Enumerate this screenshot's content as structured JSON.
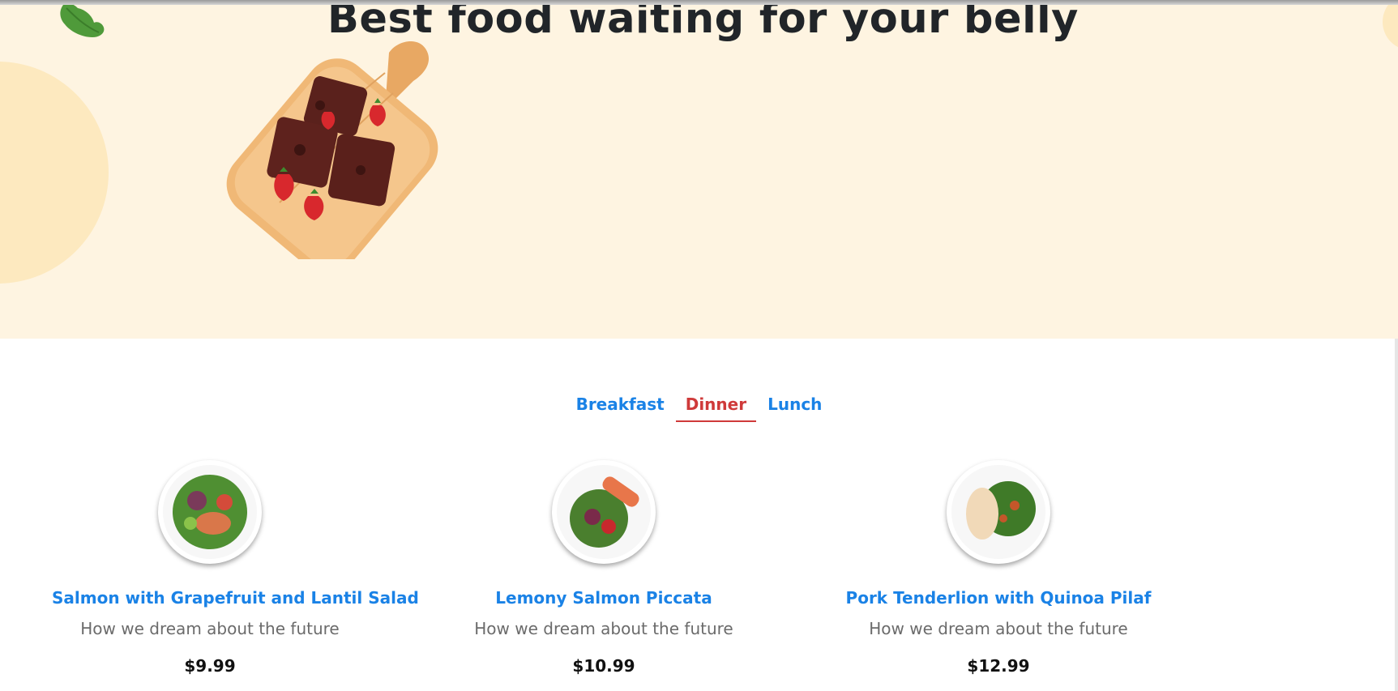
{
  "hero": {
    "title": "Best food waiting for your belly"
  },
  "colors": {
    "hero_background": "#fef4e1",
    "blob": "#fde9bf",
    "link_blue": "#1a82e6",
    "active_red": "#cf3a3a"
  },
  "tabs": [
    {
      "label": "Breakfast",
      "active": false
    },
    {
      "label": "Dinner",
      "active": true
    },
    {
      "label": "Lunch",
      "active": false
    }
  ],
  "menu_items": [
    {
      "title": "Salmon with Grapefruit and Lantil Salad",
      "description": "How we dream about the future",
      "price": "$9.99"
    },
    {
      "title": "Lemony Salmon Piccata",
      "description": "How we dream about the future",
      "price": "$10.99"
    },
    {
      "title": "Pork Tenderlion with Quinoa Pilaf",
      "description": "How we dream about the future",
      "price": "$12.99"
    }
  ]
}
